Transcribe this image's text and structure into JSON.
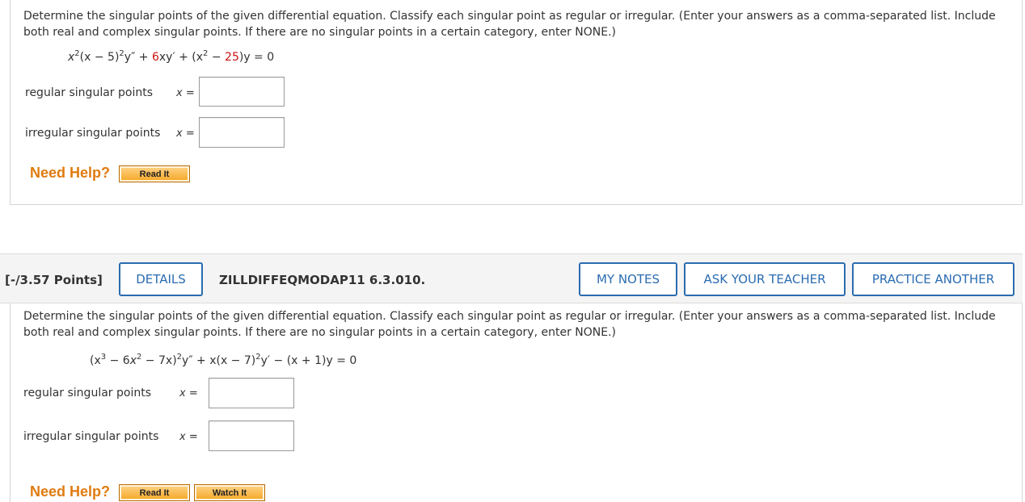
{
  "q1": {
    "instructions_line1": "Determine the singular points of the given differential equation. Classify each singular point as regular or irregular. (Enter your answers as a comma-separated list. Include",
    "instructions_line2": "both real and complex singular points. If there are no singular points in a certain category, enter NONE.)",
    "equation": {
      "p1": "x",
      "p1_sup": "2",
      "p2": "(x − 5)",
      "p2_sup": "2",
      "p3": "y″ + ",
      "coef": "6",
      "p4": "xy′ + (x",
      "p4_sup": "2",
      "p5": " − ",
      "const": "25",
      "p6": ")y = 0"
    },
    "regular_label": "regular singular points",
    "irregular_label": "irregular singular points",
    "x_eq": "x =",
    "regular_value": "",
    "irregular_value": "",
    "need_help": "Need Help?",
    "read_it": "Read It"
  },
  "q2": {
    "points": "[-/3.57 Points]",
    "details": "DETAILS",
    "code": "ZILLDIFFEQMODAP11 6.3.010.",
    "my_notes": "MY NOTES",
    "ask_teacher": "ASK YOUR TEACHER",
    "practice": "PRACTICE ANOTHER",
    "instructions_line1": "Determine the singular points of the given differential equation. Classify each singular point as regular or irregular. (Enter your answers as a comma-separated list. Include",
    "instructions_line2": "both real and complex singular points. If there are no singular points in a certain category, enter NONE.)",
    "equation": {
      "p1": "(x",
      "p1_sup": "3",
      "p2": " − ",
      "coef1": "6",
      "p3": "x",
      "p3_sup": "2",
      "p4": " − ",
      "coef2": "7",
      "p5": "x)",
      "p5_sup": "2",
      "p6": "y″ + x(x − ",
      "coef3": "7",
      "p7": ")",
      "p7_sup": "2",
      "p8": "y′ − (x + 1)y = 0"
    },
    "regular_label": "regular singular points",
    "irregular_label": "irregular singular points",
    "x_eq": "x =",
    "regular_value": "",
    "irregular_value": "",
    "need_help": "Need Help?",
    "read_it": "Read It",
    "watch_it": "Watch It"
  },
  "colors": {
    "accent_blue": "#2b6cb0",
    "help_orange": "#e07b10",
    "highlight_red": "#cc1111"
  }
}
